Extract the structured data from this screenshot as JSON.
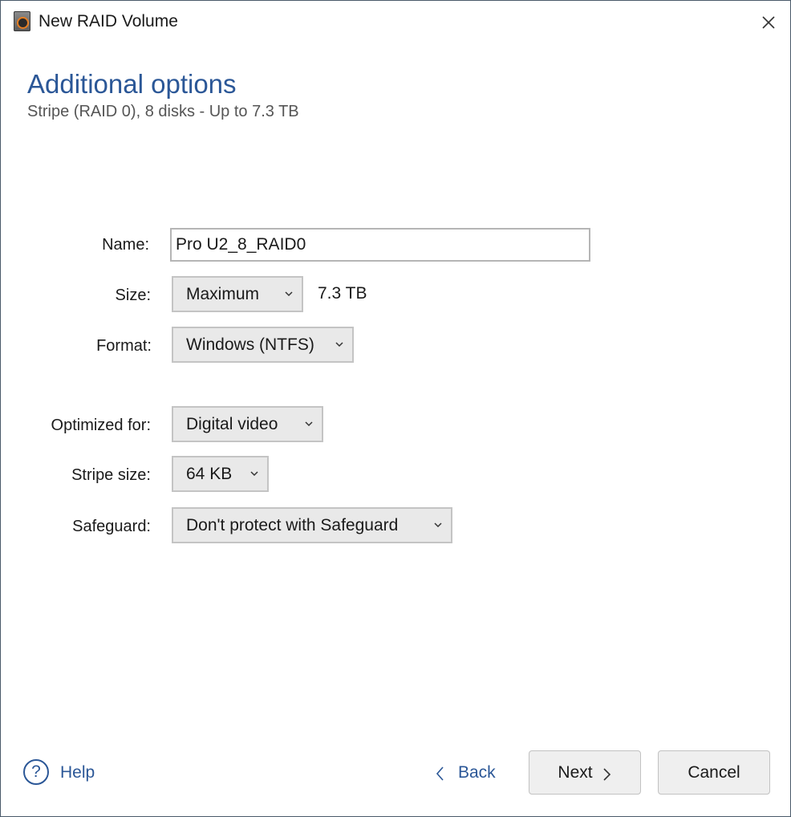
{
  "window": {
    "title": "New RAID Volume",
    "app_icon": "raid-disk-icon",
    "close_icon": "close-icon"
  },
  "header": {
    "title": "Additional options",
    "subtitle": "Stripe (RAID 0), 8 disks - Up to 7.3 TB"
  },
  "form": {
    "name": {
      "label": "Name:",
      "value": "Pro U2_8_RAID0"
    },
    "size": {
      "label": "Size:",
      "selected": "Maximum",
      "value_text": "7.3 TB"
    },
    "format": {
      "label": "Format:",
      "selected": "Windows (NTFS)"
    },
    "optimized_for": {
      "label": "Optimized for:",
      "selected": "Digital video"
    },
    "stripe_size": {
      "label": "Stripe size:",
      "selected": "64 KB"
    },
    "safeguard": {
      "label": "Safeguard:",
      "selected": "Don't protect with Safeguard"
    }
  },
  "footer": {
    "help_label": "Help",
    "help_glyph": "?",
    "back_label": "Back",
    "next_label": "Next",
    "cancel_label": "Cancel"
  },
  "colors": {
    "accent": "#2b5797",
    "dropdown_bg": "#e9e9e9",
    "button_bg": "#efefef",
    "subtitle": "#555555"
  }
}
